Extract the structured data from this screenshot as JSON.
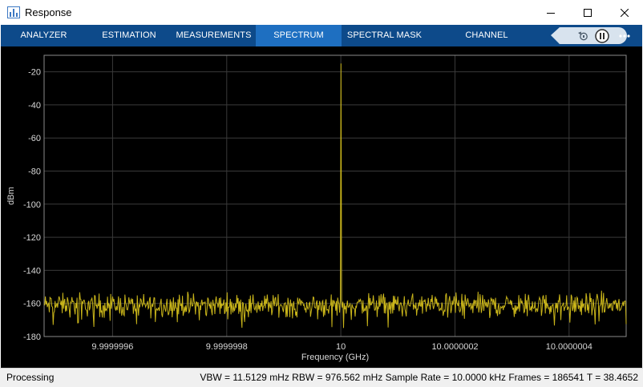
{
  "window": {
    "title": "Response"
  },
  "toolstrip": {
    "tabs": [
      {
        "label": "ANALYZER",
        "active": false
      },
      {
        "label": "ESTIMATION",
        "active": false
      },
      {
        "label": "MEASUREMENTS",
        "active": false
      },
      {
        "label": "SPECTRUM",
        "active": true
      },
      {
        "label": "SPECTRAL MASK",
        "active": false
      },
      {
        "label": "CHANNEL MEASUREMENTS",
        "active": false
      }
    ],
    "controls": [
      "step-back-icon",
      "pause-icon",
      "more-options-icon"
    ]
  },
  "status": {
    "state": "Processing",
    "readout": "VBW = 11.5129 mHz  RBW = 976.562 mHz  Sample Rate = 10.0000 kHz  Frames = 186541  T = 38.4652"
  },
  "colors": {
    "toolstrip_bg": "#0d4a8a",
    "active_tab": "#1e6fc1",
    "trace": "#c9b51a",
    "plot_bg": "#000000",
    "grid": "#3a3a3a"
  },
  "chart_data": {
    "type": "line",
    "xlabel": "Frequency (GHz)",
    "ylabel": "dBm",
    "xlim": [
      9.99999948,
      10.0000005
    ],
    "ylim": [
      -180,
      -10
    ],
    "x_ticks": [
      {
        "value": 9.9999996,
        "label": "9.9999996"
      },
      {
        "value": 9.9999998,
        "label": "9.9999998"
      },
      {
        "value": 10.0,
        "label": "10"
      },
      {
        "value": 10.0000002,
        "label": "10.0000002"
      },
      {
        "value": 10.0000004,
        "label": "10.0000004"
      }
    ],
    "y_ticks": [
      -20,
      -40,
      -60,
      -80,
      -100,
      -120,
      -140,
      -160,
      -180
    ],
    "grid": true,
    "series": [
      {
        "peak": {
          "x": 10.0,
          "y": -15
        },
        "noise_floor_dbm": -161,
        "noise_range_dbm": [
          -175,
          -150
        ]
      }
    ]
  }
}
